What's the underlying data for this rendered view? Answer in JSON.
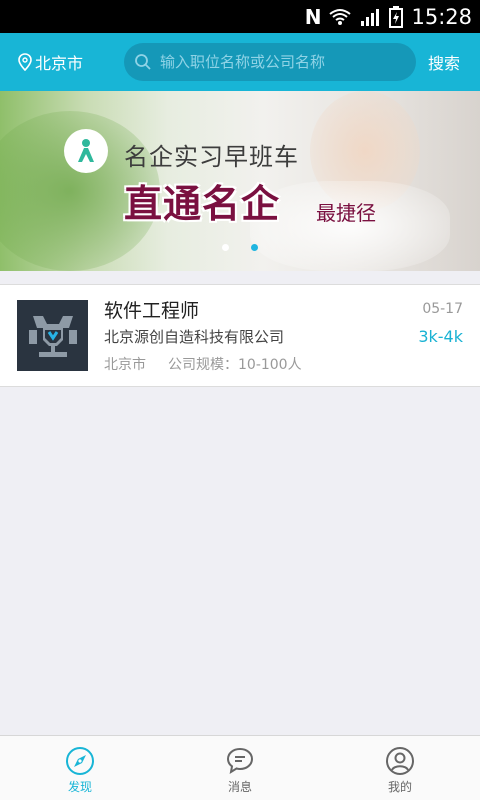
{
  "status_bar": {
    "time": "15:28",
    "icons": [
      "nfc-icon",
      "wifi-icon",
      "signal-icon",
      "battery-icon"
    ],
    "nfc_glyph": "N"
  },
  "header": {
    "location": "北京市",
    "search_placeholder": "输入职位名称或公司名称",
    "search_button": "搜索",
    "color": "#18b5d6"
  },
  "banner": {
    "subtitle": "名企实习早班车",
    "main_text": "直通名企",
    "small_text": "最捷径",
    "dots": 2,
    "active_dot": 2
  },
  "jobs": [
    {
      "title": "软件工程师",
      "company": "北京源创自造科技有限公司",
      "city": "北京市",
      "scale": "公司规模：10-100人",
      "date": "05-17",
      "salary": "3k-4k"
    }
  ],
  "bottom_nav": {
    "items": [
      {
        "label": "发现",
        "icon": "compass-icon",
        "active": true
      },
      {
        "label": "消息",
        "icon": "message-icon",
        "active": false
      },
      {
        "label": "我的",
        "icon": "user-icon",
        "active": false
      }
    ],
    "active_color": "#18b5d6"
  }
}
